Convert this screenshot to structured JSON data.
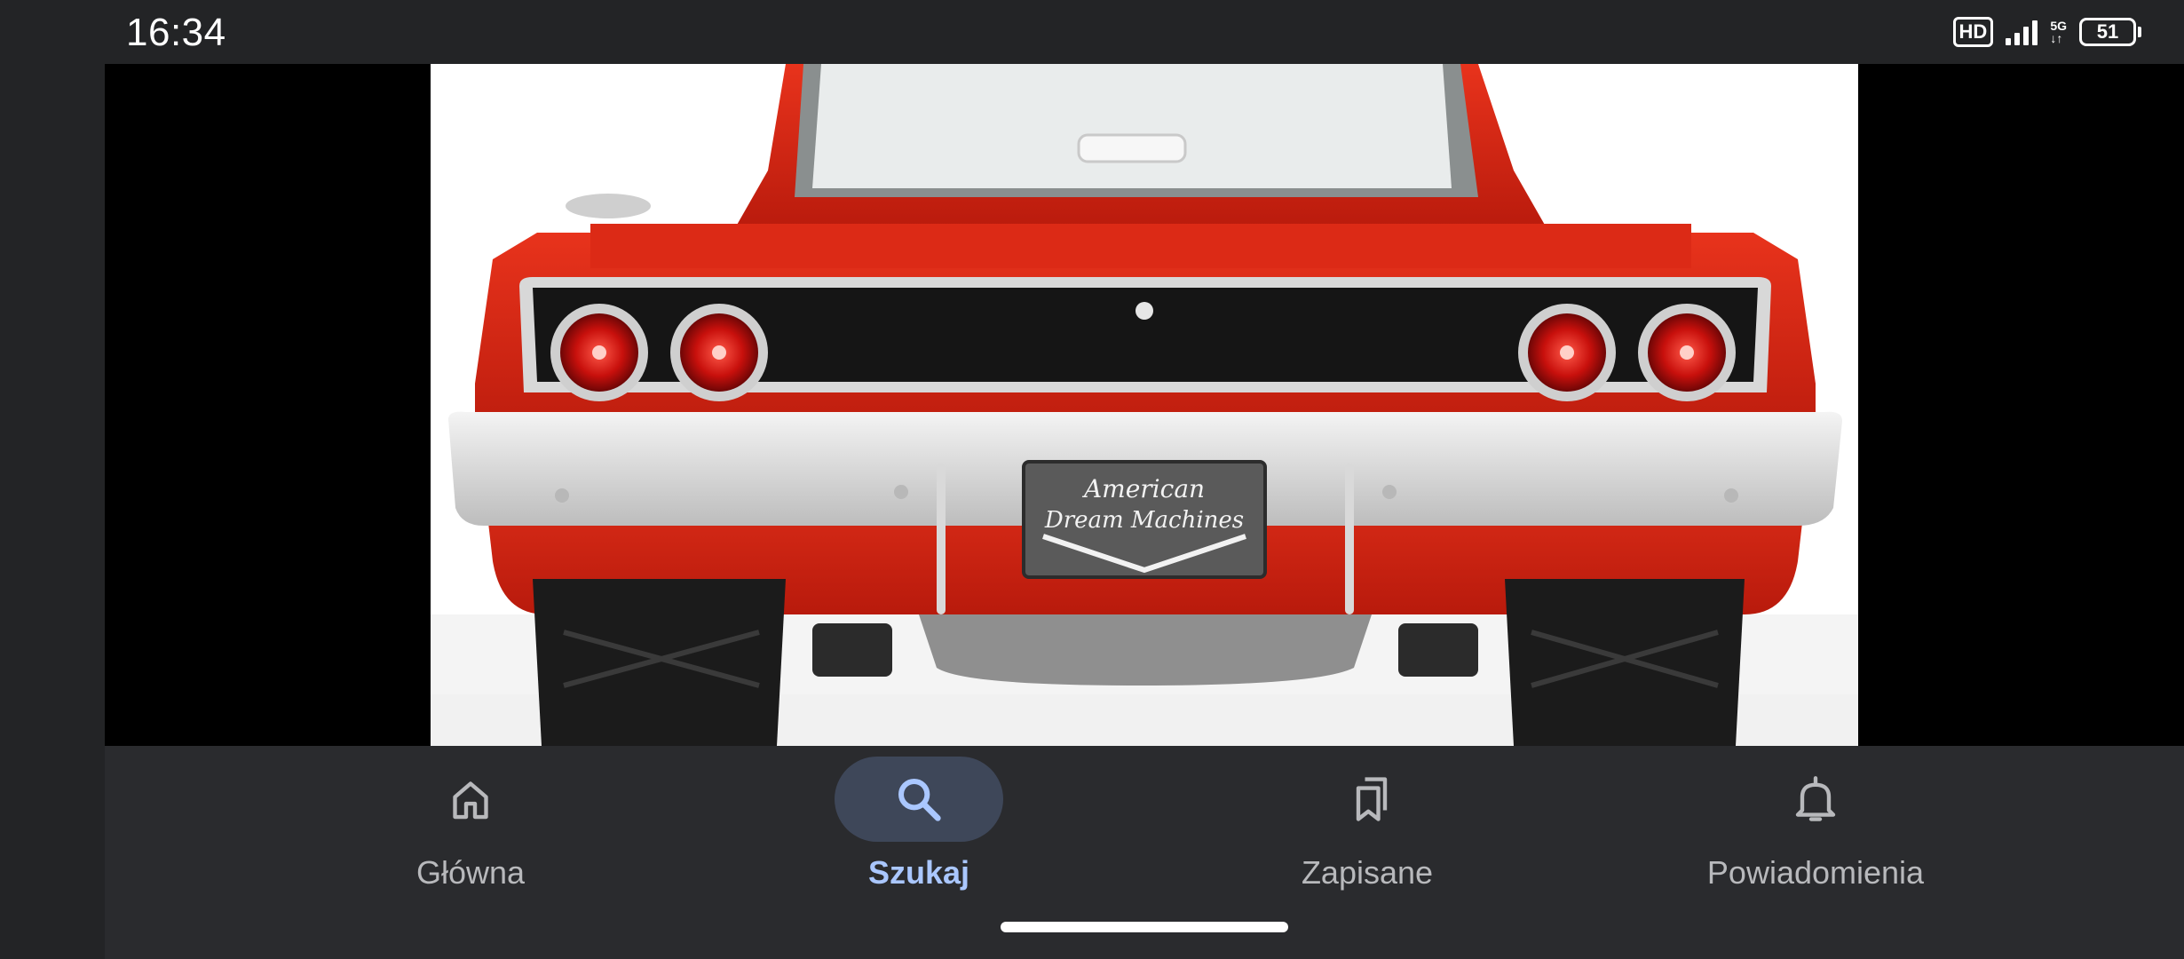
{
  "status_bar": {
    "time": "16:34",
    "hd_label": "HD",
    "network_label": "5G",
    "battery_level": "51",
    "icons": [
      "signal-icon",
      "5g-icon",
      "battery-icon"
    ]
  },
  "viewer": {
    "photo_subject": "car-rear-image",
    "plate_line1": "American",
    "plate_line2": "Dream Machines"
  },
  "bottom_nav": {
    "items": [
      {
        "label": "Główna",
        "icon": "home-icon",
        "active": false
      },
      {
        "label": "Szukaj",
        "icon": "search-icon",
        "active": true
      },
      {
        "label": "Zapisane",
        "icon": "saved-icon",
        "active": false
      },
      {
        "label": "Powiadomienia",
        "icon": "bell-icon",
        "active": false
      }
    ]
  },
  "colors": {
    "accent": "#aac7ff",
    "active_pill": "#3e4759",
    "nav_background": "#2a2b2e",
    "car_red": "#d62612"
  }
}
